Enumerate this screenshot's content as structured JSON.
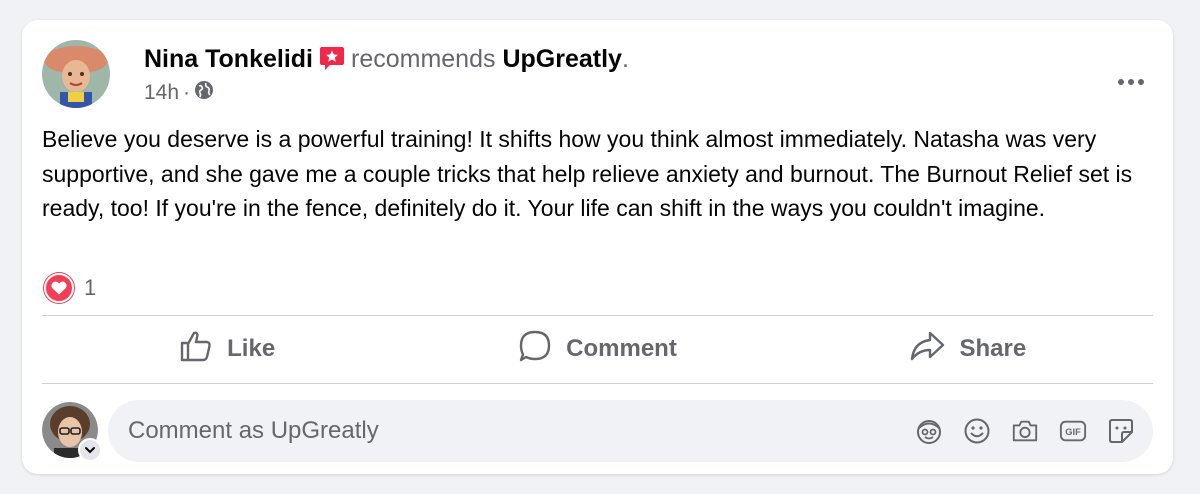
{
  "post": {
    "author": "Nina Tonkelidi",
    "verb": "recommends",
    "page": "UpGreatly",
    "time": "14h",
    "separator": "·",
    "privacy_icon": "globe-icon",
    "text": "Believe you deserve is a powerful training!  It shifts how you think almost immediately. Natasha was very supportive, and she gave me a couple tricks that help relieve anxiety and burnout. The Burnout Relief set is ready, too! If you're in the fence,  definitely do it.  Your life can shift in the ways you couldn't imagine.",
    "reaction_icon": "love-reaction-icon",
    "reaction_count": "1"
  },
  "actions": {
    "like": "Like",
    "comment": "Comment",
    "share": "Share"
  },
  "composer": {
    "placeholder": "Comment as UpGreatly",
    "tools": [
      "avatar-sticker-icon",
      "emoji-icon",
      "camera-icon",
      "gif-icon",
      "sticker-icon"
    ],
    "gif_label": "GIF"
  },
  "colors": {
    "recommend_badge": "#f02849",
    "love": "#f33e58",
    "secondary_text": "#65676b"
  }
}
